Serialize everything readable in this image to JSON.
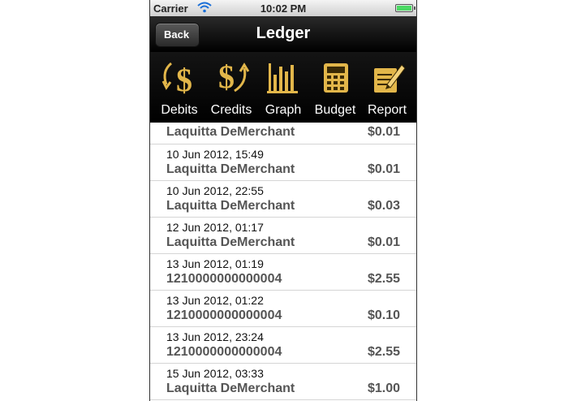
{
  "status_bar": {
    "carrier": "Carrier",
    "time": "10:02 PM"
  },
  "nav": {
    "back_label": "Back",
    "title": "Ledger"
  },
  "toolbar": [
    {
      "label": "Debits",
      "icon": "dollar-arrow-down-icon"
    },
    {
      "label": "Credits",
      "icon": "dollar-arrow-up-icon"
    },
    {
      "label": "Graph",
      "icon": "bar-graph-icon"
    },
    {
      "label": "Budget",
      "icon": "calculator-icon"
    },
    {
      "label": "Report",
      "icon": "notepad-pencil-icon"
    }
  ],
  "colors": {
    "icon_gold": "#e2b64a",
    "navbar": "#000000",
    "name_text": "#555555"
  },
  "ledger": [
    {
      "date": "",
      "name": "Laquitta DeMerchant",
      "amount": "$0.01"
    },
    {
      "date": "10 Jun 2012, 15:49",
      "name": "Laquitta DeMerchant",
      "amount": "$0.01"
    },
    {
      "date": "10 Jun 2012, 22:55",
      "name": "Laquitta DeMerchant",
      "amount": "$0.03"
    },
    {
      "date": "12 Jun 2012, 01:17",
      "name": "Laquitta DeMerchant",
      "amount": "$0.01"
    },
    {
      "date": "13 Jun 2012, 01:19",
      "name": "1210000000000004",
      "amount": "$2.55"
    },
    {
      "date": "13 Jun 2012, 01:22",
      "name": "1210000000000004",
      "amount": "$0.10"
    },
    {
      "date": "13 Jun 2012, 23:24",
      "name": "1210000000000004",
      "amount": "$2.55"
    },
    {
      "date": "15 Jun 2012, 03:33",
      "name": "Laquitta DeMerchant",
      "amount": "$1.00"
    }
  ]
}
